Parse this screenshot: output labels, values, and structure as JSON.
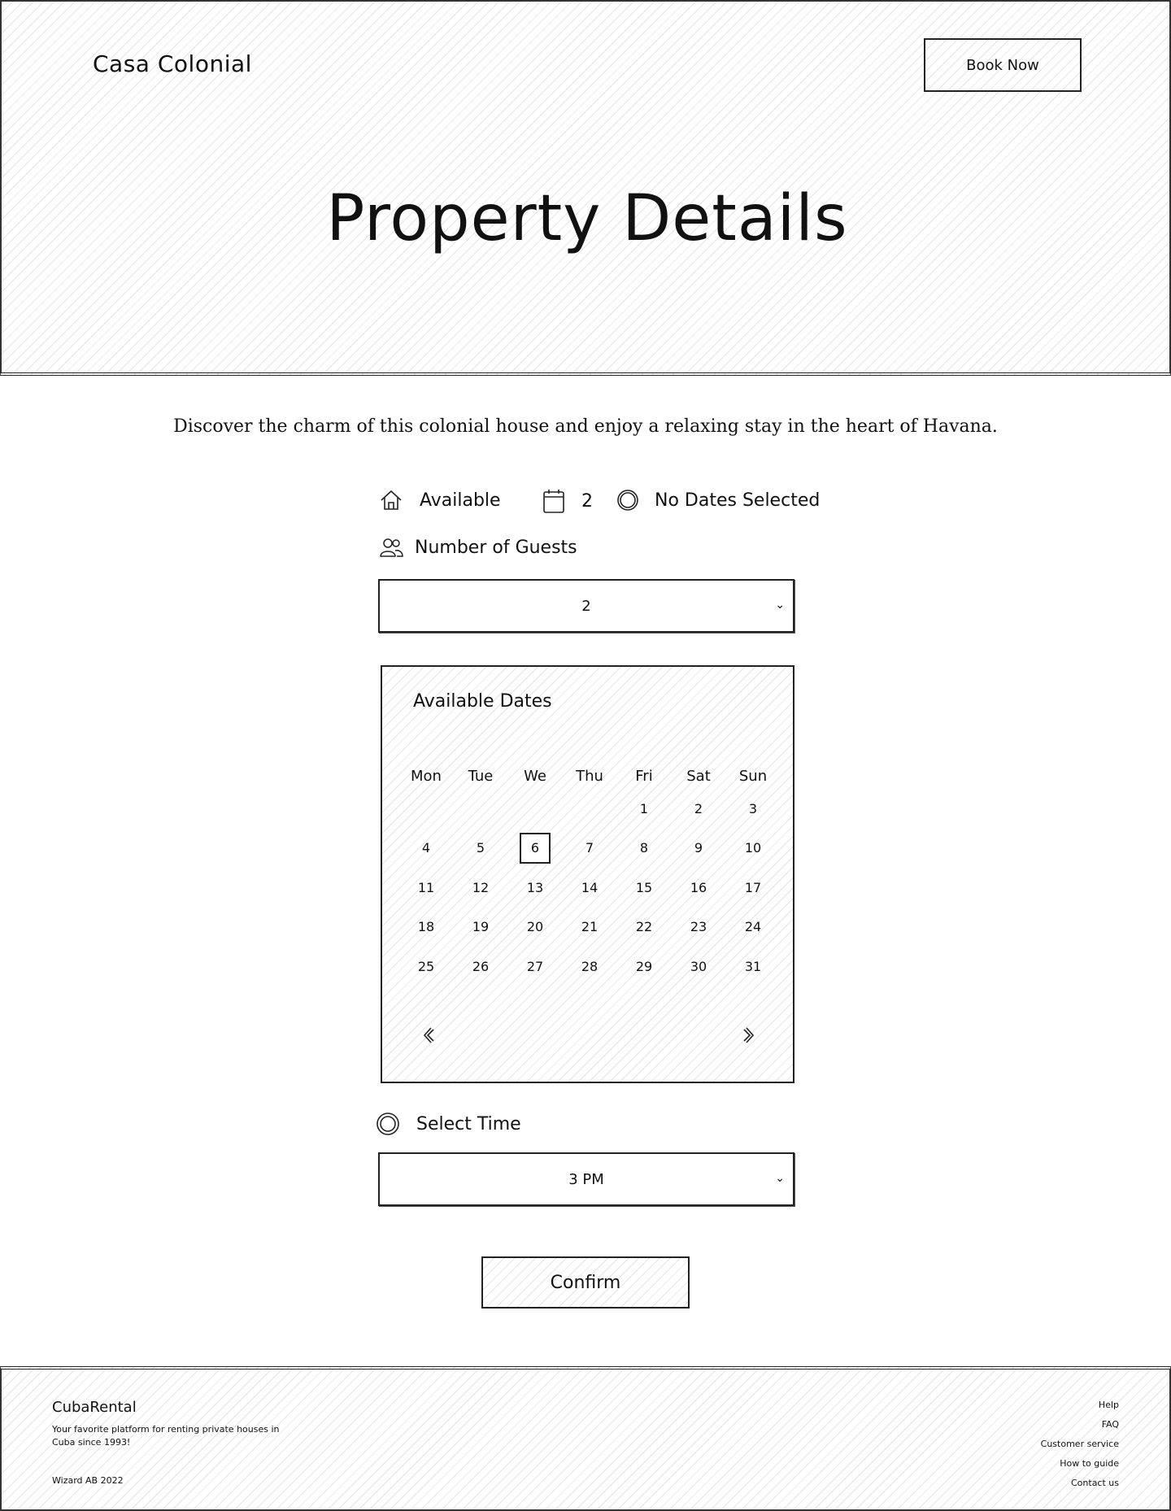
{
  "header": {
    "brand": "Casa Colonial",
    "book_button": "Book Now",
    "title": "Property Details"
  },
  "intro": "Discover the charm of this colonial house and enjoy a relaxing stay in the heart of Havana.",
  "status": {
    "availability": "Available",
    "nights": "2",
    "dates": "No Dates Selected"
  },
  "guests": {
    "label": "Number of Guests",
    "value": "2"
  },
  "calendar": {
    "title": "Available Dates",
    "weekdays": [
      "Mon",
      "Tue",
      "We",
      "Thu",
      "Fri",
      "Sat",
      "Sun"
    ],
    "days": [
      "1",
      "2",
      "3",
      "4",
      "5",
      "6",
      "7",
      "8",
      "9",
      "10",
      "11",
      "12",
      "13",
      "14",
      "15",
      "16",
      "17",
      "18",
      "19",
      "20",
      "21",
      "22",
      "23",
      "24",
      "25",
      "26",
      "27",
      "28",
      "29",
      "30",
      "31"
    ],
    "first_weekday_index": 4,
    "selected_day": "6"
  },
  "time": {
    "label": "Select Time",
    "value": "3 PM"
  },
  "confirm_button": "Confirm",
  "footer": {
    "brand": "CubaRental",
    "tagline": "Your favorite platform for renting private houses in Cuba since 1993!",
    "copyright": "Wizard AB 2022",
    "links": [
      "Help",
      "FAQ",
      "Customer service",
      "How to guide",
      "Contact us"
    ]
  }
}
